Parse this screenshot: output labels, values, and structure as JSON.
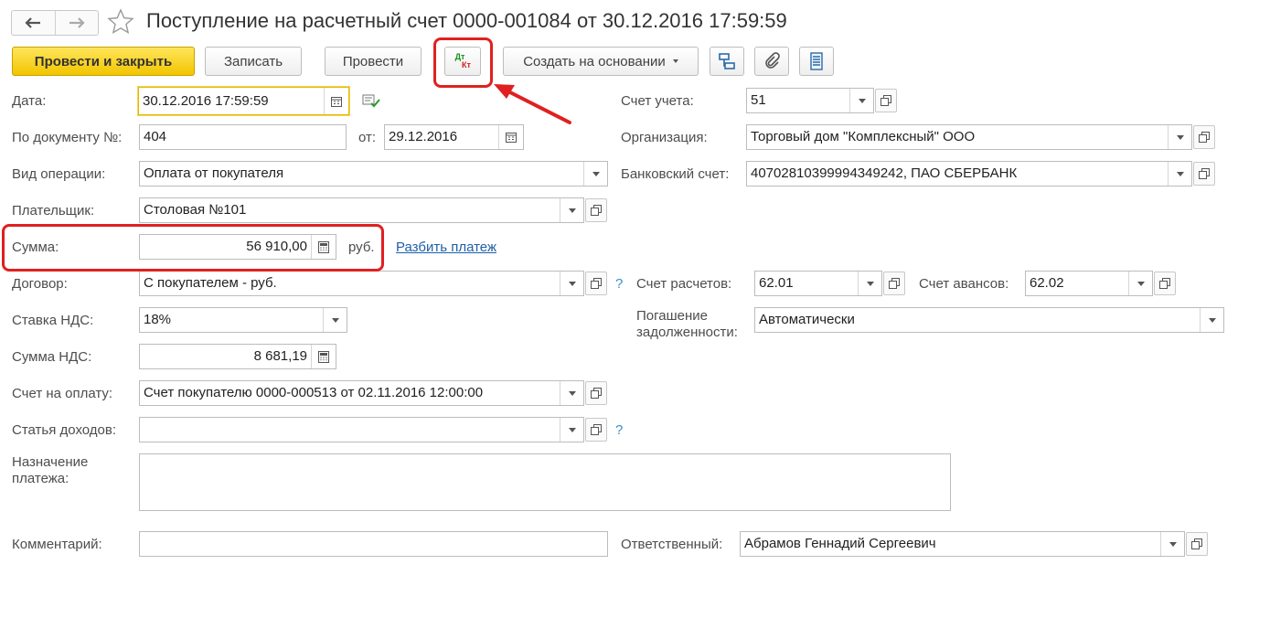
{
  "header": {
    "title": "Поступление на расчетный счет 0000-001084 от 30.12.2016 17:59:59"
  },
  "toolbar": {
    "post_close": "Провести и закрыть",
    "save": "Записать",
    "post": "Провести",
    "dtkt_top": "Дт",
    "dtkt_bottom": "Кт",
    "create_based": "Создать на основании"
  },
  "form": {
    "date_label": "Дата:",
    "date_value": "30.12.2016 17:59:59",
    "docnum_label": "По документу №:",
    "docnum_value": "404",
    "from_label": "от:",
    "from_value": "29.12.2016",
    "optype_label": "Вид операции:",
    "optype_value": "Оплата от покупателя",
    "payer_label": "Плательщик:",
    "payer_value": "Столовая №101",
    "sum_label": "Сумма:",
    "sum_value": "56 910,00",
    "currency": "руб.",
    "split_link": "Разбить платеж",
    "contract_label": "Договор:",
    "contract_value": "С покупателем - руб.",
    "vat_rate_label": "Ставка НДС:",
    "vat_rate_value": "18%",
    "vat_sum_label": "Сумма НДС:",
    "vat_sum_value": "8 681,19",
    "invoice_label": "Счет на оплату:",
    "invoice_value": "Счет покупателю 0000-000513 от 02.11.2016 12:00:00",
    "income_label": "Статья доходов:",
    "income_value": "",
    "purpose_label_1": "Назначение",
    "purpose_label_2": "платежа:",
    "purpose_value": "",
    "comment_label": "Комментарий:",
    "comment_value": "",
    "account_label": "Счет учета:",
    "account_value": "51",
    "org_label": "Организация:",
    "org_value": "Торговый дом \"Комплексный\" ООО",
    "bank_label": "Банковский счет:",
    "bank_value": "40702810399994349242, ПАО СБЕРБАНК",
    "settle_label": "Счет расчетов:",
    "settle_value": "62.01",
    "advance_label": "Счет авансов:",
    "advance_value": "62.02",
    "repay_label_1": "Погашение",
    "repay_label_2": "задолженности:",
    "repay_value": "Автоматически",
    "resp_label": "Ответственный:",
    "resp_value": "Абрамов Геннадий Сергеевич",
    "help": "?"
  },
  "colors": {
    "primary": "#f2c500",
    "annotation": "#e02020",
    "link": "#1f5fa8"
  }
}
